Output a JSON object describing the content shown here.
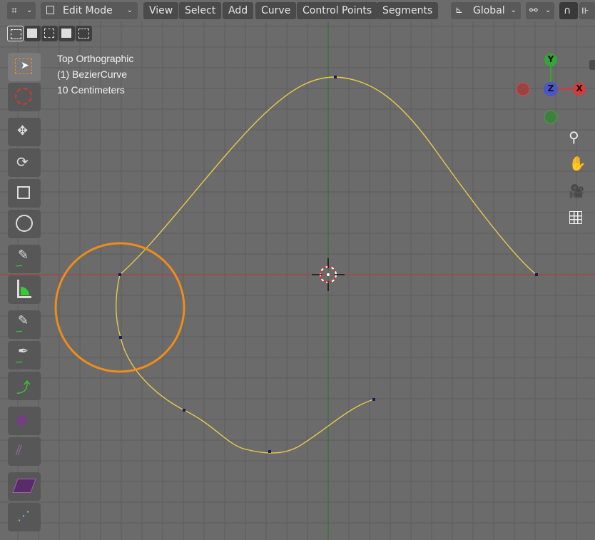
{
  "header": {
    "mode_label": "Edit Mode",
    "menus": [
      "View",
      "Select",
      "Add",
      "Curve",
      "Control Points",
      "Segments"
    ],
    "orientation_label": "Global"
  },
  "overlay_info": {
    "view_name": "Top Orthographic",
    "object_name": "(1) BezierCurve",
    "scale": "10 Centimeters"
  },
  "gizmo": {
    "y": "Y",
    "z": "Z",
    "x": "X"
  },
  "colors": {
    "viewport_bg": "#6b6b6b",
    "curve": "#e8c84a",
    "x_axis": "#b03a3a",
    "y_axis": "#3d7a3d",
    "brush_circle": "#f08c1a",
    "gizmo_x": "#d33c3c",
    "gizmo_y": "#35a535",
    "gizmo_z": "#4a55c8"
  },
  "toolbar": {
    "tools": [
      "select-box",
      "cursor",
      "move",
      "rotate",
      "scale",
      "transform",
      "annotate",
      "measure",
      "draw",
      "pen",
      "curve-pen",
      "tilt",
      "randomize",
      "extrude",
      "vertex-slide"
    ]
  }
}
